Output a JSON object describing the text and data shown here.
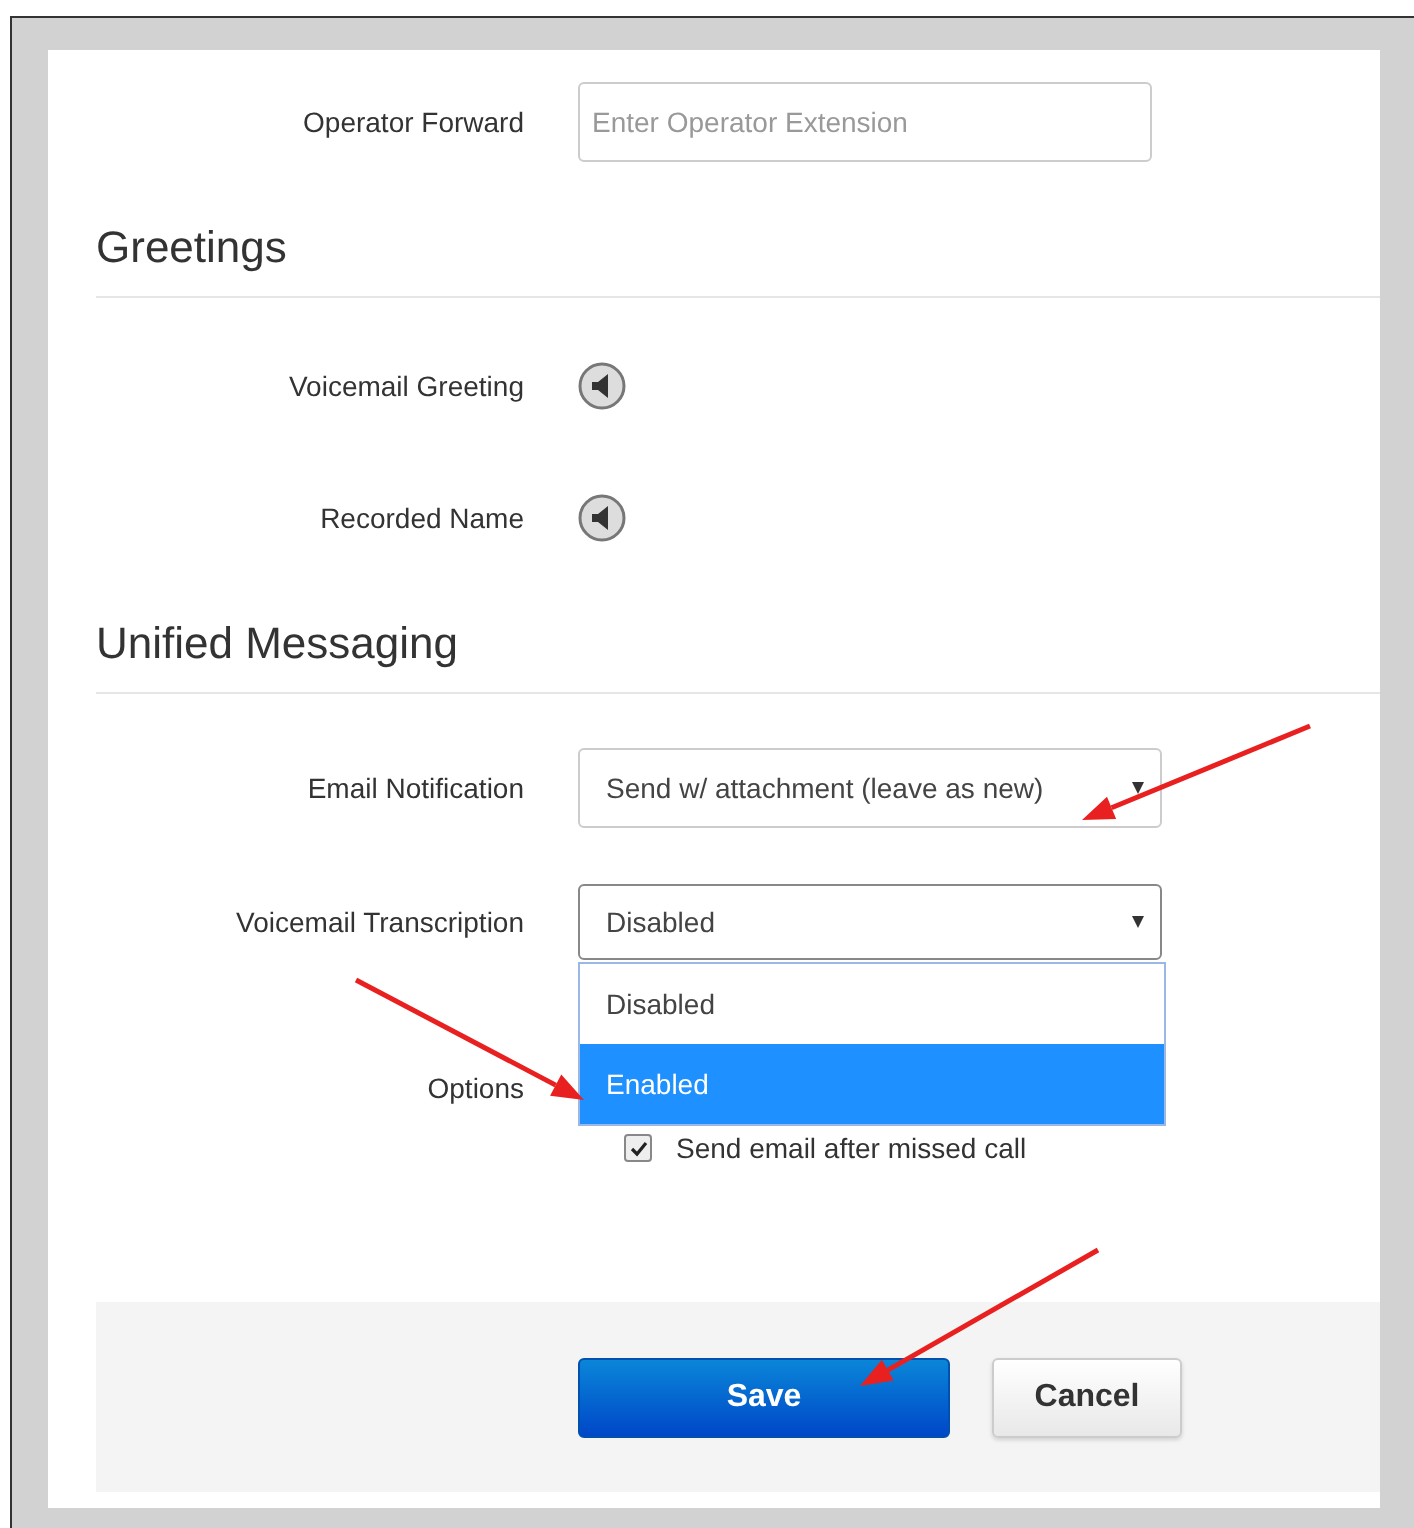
{
  "operator_forward": {
    "label": "Operator Forward",
    "placeholder": "Enter Operator Extension"
  },
  "greetings": {
    "title": "Greetings",
    "rows": [
      {
        "label": "Voicemail Greeting"
      },
      {
        "label": "Recorded Name"
      }
    ]
  },
  "unified_messaging": {
    "title": "Unified Messaging",
    "email_notification": {
      "label": "Email Notification",
      "value": "Send w/ attachment (leave as new)"
    },
    "voicemail_transcription": {
      "label": "Voicemail Transcription",
      "value": "Disabled",
      "expanded": true,
      "options": [
        {
          "label": "Disabled",
          "highlighted": false
        },
        {
          "label": "Enabled",
          "highlighted": true
        }
      ]
    },
    "options": {
      "label": "Options",
      "checkbox": {
        "label": "Send email after missed call",
        "checked": true
      }
    }
  },
  "buttons": [
    {
      "label": "Save",
      "kind": "primary"
    },
    {
      "label": "Cancel",
      "kind": "secondary"
    }
  ]
}
